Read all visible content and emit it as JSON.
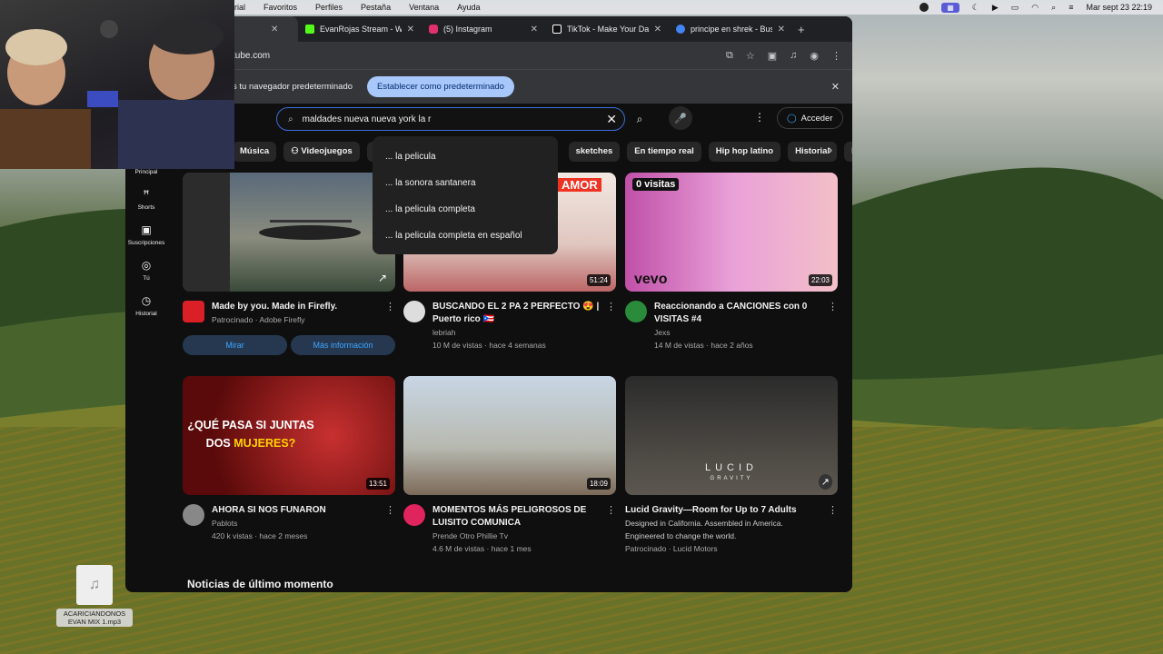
{
  "menubar": {
    "menus": [
      "rial",
      "Favoritos",
      "Perfiles",
      "Pestaña",
      "Ventana",
      "Ayuda"
    ],
    "clock": "Mar sept 23  22:19"
  },
  "browser": {
    "tabs": [
      {
        "label": "",
        "active": true
      },
      {
        "label": "EvanRojas Stream - Wa",
        "icon_color": "#53fc18"
      },
      {
        "label": "(5) Instagram",
        "icon_color": "#e1306c"
      },
      {
        "label": "TikTok - Make Your Day",
        "icon_color": "#ffffff"
      },
      {
        "label": "principe en shrek - Bus",
        "icon_color": "#4285f4"
      }
    ],
    "url": "tube.com",
    "infobar": {
      "message": "s tu navegador predeterminado",
      "button": "Establecer como predeterminado"
    }
  },
  "youtube": {
    "search_query": "maldades nueva nueva york la r",
    "signin": "Acceder",
    "suggestions": [
      "... la pelicula",
      "... la sonora santanera",
      "... la pelicula completa",
      "... la pelicula completa en español"
    ],
    "chips": [
      "Música",
      "Videojuegos",
      "M",
      "sketches",
      "En tiempo real",
      "Hip hop latino",
      "Historial",
      "F"
    ],
    "guide": [
      {
        "label": "Principal",
        "icon": "home-icon"
      },
      {
        "label": "Shorts",
        "icon": "shorts-icon"
      },
      {
        "label": "Suscripciones",
        "icon": "subscriptions-icon"
      },
      {
        "label": "Tú",
        "icon": "you-icon"
      },
      {
        "label": "Historial",
        "icon": "history-icon"
      }
    ],
    "videos": [
      {
        "title": "Made by you. Made in Firefly.",
        "channel": "Patrocinado · Adobe Firefly",
        "stats": "",
        "duration": "",
        "ad": true,
        "buttons": [
          "Mirar",
          "Más información"
        ]
      },
      {
        "title": "BUSCANDO EL 2 PA 2 PERFECTO 😍 | Puerto rico 🇵🇷",
        "channel": "lebriah",
        "stats": "10 M de vistas · hace 4 semanas",
        "duration": "51:24",
        "thumb_text": "AMOR"
      },
      {
        "title": "Reaccionando a CANCIONES con 0 VISITAS #4",
        "channel": "Jexs",
        "stats": "14 M de vistas · hace 2 años",
        "duration": "22:03",
        "thumb_text": "0 visitas",
        "thumb_text2": "vevo"
      },
      {
        "title": "AHORA SI NOS FUNARON",
        "channel": "Pablots",
        "stats": "420 k vistas · hace 2 meses",
        "duration": "13:51",
        "thumb_text": "¿QUÉ PASA SI JUNTAS",
        "thumb_text2": "DOS",
        "thumb_text3": "MUJERES?"
      },
      {
        "title": "MOMENTOS MÁS PELIGROSOS DE LUISITO COMUNICA",
        "channel": "Prende Otro Phillie Tv",
        "stats": "4.6 M de vistas · hace 1 mes",
        "duration": "18:09"
      },
      {
        "title": "Lucid Gravity—Room for Up to 7 Adults",
        "channel": "Designed in California. Assembled in America. Engineered to change the world.",
        "stats": "Patrocinado · Lucid Motors",
        "duration": "",
        "ad": true,
        "thumb_text": "LUCID",
        "thumb_text2": "GRAVITY"
      }
    ],
    "section_title": "Noticias de último momento"
  },
  "desktop": {
    "file_name": "ACARICIANDONOS EVAN MIX 1.mp3"
  }
}
